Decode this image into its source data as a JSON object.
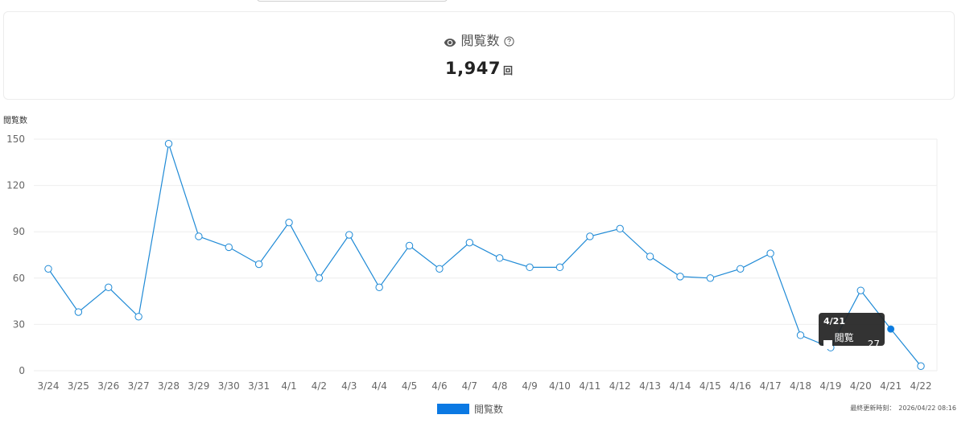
{
  "header": {
    "title": "閲覧数",
    "value": "1,947",
    "unit": "回"
  },
  "chart_data": {
    "type": "line",
    "ylabel": "閲覧数",
    "ylim": [
      0,
      150
    ],
    "yticks": [
      0,
      30,
      60,
      90,
      120,
      150
    ],
    "grid": true,
    "legend": "bottom",
    "categories": [
      "3/24",
      "3/25",
      "3/26",
      "3/27",
      "3/28",
      "3/29",
      "3/30",
      "3/31",
      "4/1",
      "4/2",
      "4/3",
      "4/4",
      "4/5",
      "4/6",
      "4/7",
      "4/8",
      "4/9",
      "4/10",
      "4/11",
      "4/12",
      "4/13",
      "4/14",
      "4/15",
      "4/16",
      "4/17",
      "4/18",
      "4/19",
      "4/20",
      "4/21",
      "4/22"
    ],
    "series": [
      {
        "name": "閲覧数",
        "color": "#1f8ad6",
        "values": [
          66,
          38,
          54,
          35,
          147,
          87,
          80,
          69,
          96,
          60,
          88,
          54,
          81,
          66,
          83,
          73,
          67,
          67,
          87,
          92,
          74,
          61,
          60,
          66,
          76,
          23,
          15,
          52,
          27,
          3
        ]
      }
    ]
  },
  "legend": {
    "label": "閲覧数",
    "color": "#0b79e3"
  },
  "tooltip": {
    "title": "4/21",
    "label": "閲覧数:",
    "value": "27",
    "index": 28
  },
  "footer": {
    "updated_label": "最終更新時刻：",
    "updated_value": "2026/04/22 08:16"
  }
}
